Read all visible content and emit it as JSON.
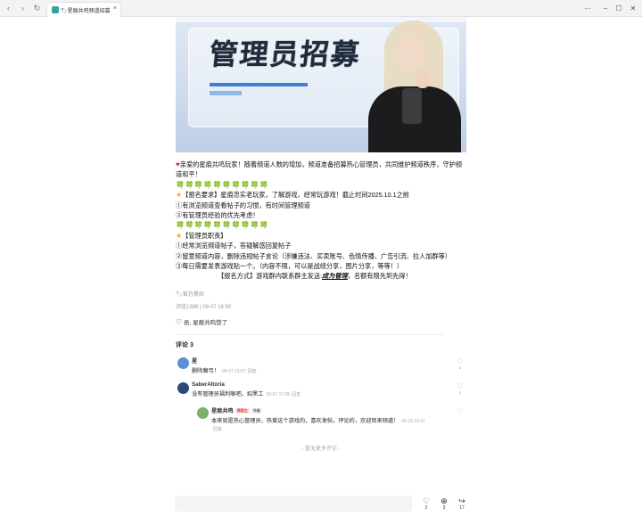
{
  "browser": {
    "back_icon": "back-arrow-icon",
    "forward_icon": "forward-arrow-icon",
    "reload_icon": "reload-icon",
    "tab_title": "🏷星痕共鸣频道招募...",
    "tab_close": "×",
    "window_controls": [
      "⋯",
      "–",
      "☐",
      "✕"
    ]
  },
  "banner": {
    "title": "管理员招募"
  },
  "post": {
    "lines": [
      {
        "icon": "heart",
        "text": "亲爱的星痕共鸣玩家！随着频道人数的增加，频道准备招募热心管理员，共同维护频道秩序，守护频道和平！"
      },
      {
        "icon": "leaves",
        "text": "🍀🍀🍀🍀🍀🍀🍀🍀🍀🍀"
      },
      {
        "icon": "star",
        "text": "【报名要求】星痕忠实老玩家，了解游戏，经常玩游戏！截止时间2025.10.1之前"
      },
      {
        "icon": "",
        "text": "①有浏览频道查看帖子的习惯，有时间管理频道"
      },
      {
        "icon": "",
        "text": "②有管理员经验的优先考虑！"
      },
      {
        "icon": "leaves",
        "text": "🍀🍀🍀🍀🍀🍀🍀🍀🍀🍀"
      },
      {
        "icon": "star",
        "text": "【管理员职责】"
      },
      {
        "icon": "",
        "text": "①经常浏览频道帖子，答疑解惑回复帖子"
      },
      {
        "icon": "",
        "text": "②留意频道内容，删除违规帖子言论（涉嫌违法、买卖账号、色情传播、广告引流、拉人加群等）"
      },
      {
        "icon": "",
        "text": "③每日需要发表游戏贴一个。（内容不限，可以是战绩分享，图片分享，等等！）"
      }
    ],
    "signup_prefix": "【报名方式】游戏群内联系群主发送:",
    "signup_link": "成为管理",
    "signup_suffix": "，名额有限先到先得！",
    "tag": "🏷官方资讯",
    "stats": "浏览1386 | 09-07 16:50",
    "likers": "邑, 星痕共鸣赞了"
  },
  "comments": {
    "title": "评论 3",
    "items": [
      {
        "name": "星",
        "text": "删除魔弓！",
        "time": "09-07 16:57",
        "reply": "回复",
        "likes": "1",
        "avatar_color": "#5a8fd6"
      },
      {
        "name": "SaberAltoria",
        "text": "没有管理员福利嘛吧。招黑工",
        "time": "09-07 17:05",
        "reply": "回复",
        "likes": "1",
        "avatar_color": "#2b4a7a"
      }
    ],
    "sub_reply": {
      "name": "星痕共鸣",
      "badge_owner": "频道主",
      "badge_author": "作者",
      "text": "本来就是热心管理员，热爱这个游戏的，喜欢发帖，评论的，欢迎到来频道！",
      "time": "09-10 16:01",
      "reply": "回复",
      "avatar_color": "#7ab06a"
    },
    "end_text": "- 暂无更多评论 -"
  },
  "bottom_bar": {
    "like_count": "2",
    "comment_count": "3",
    "share_count": "17"
  }
}
